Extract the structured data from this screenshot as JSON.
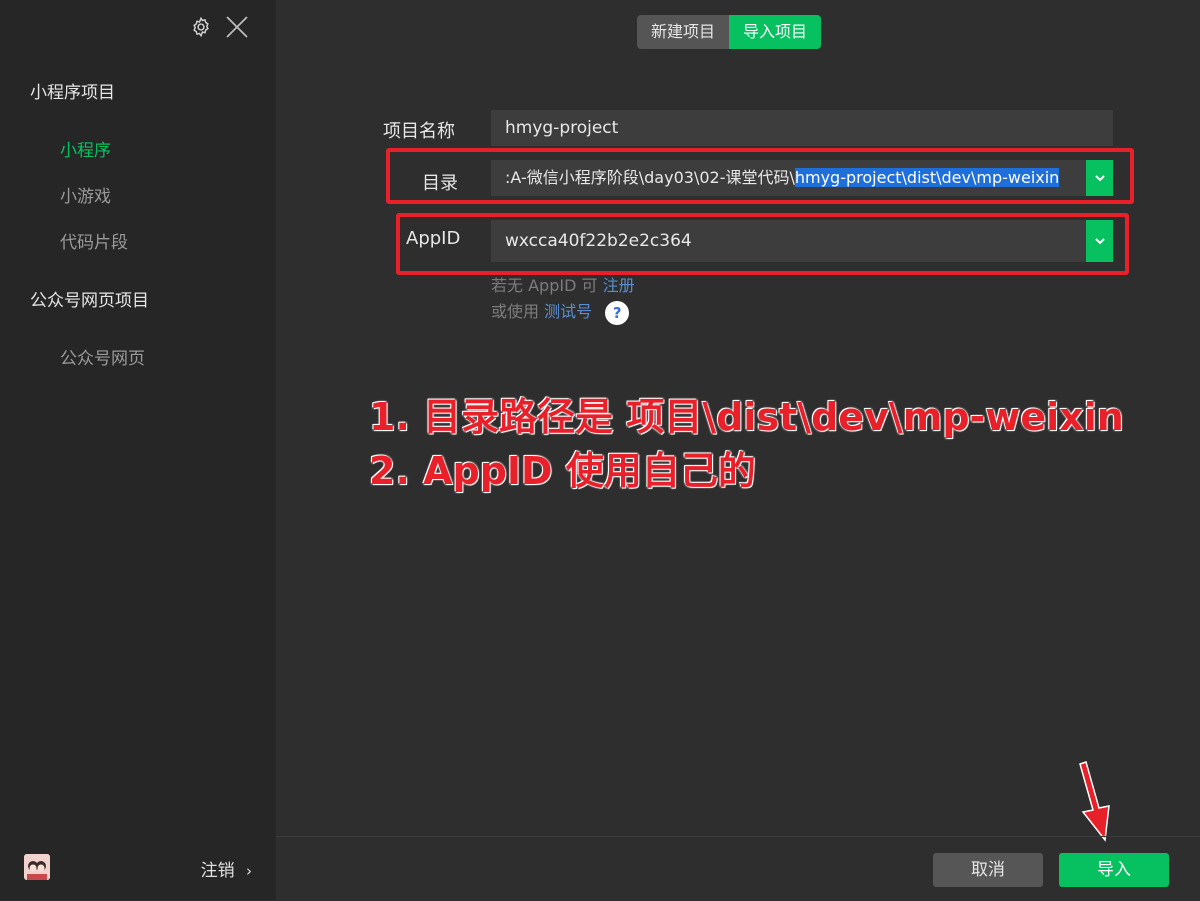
{
  "sidebar": {
    "sections": [
      {
        "title": "小程序项目",
        "items": [
          "小程序",
          "小游戏",
          "代码片段"
        ]
      },
      {
        "title": "公众号网页项目",
        "items": [
          "公众号网页"
        ]
      }
    ],
    "logout_label": "注销"
  },
  "tabs": {
    "new_project": "新建项目",
    "import_project": "导入项目"
  },
  "form": {
    "name_label": "项目名称",
    "name_value": "hmyg-project",
    "dir_label": "目录",
    "dir_value_prefix": ":A-微信小程序阶段\\day03\\02-课堂代码\\",
    "dir_value_selected": "hmyg-project\\dist\\dev\\mp-weixin",
    "appid_label": "AppID",
    "appid_value": "wxcca40f22b2e2c364",
    "hint_no_appid": "若无 AppID 可",
    "hint_register": "注册",
    "hint_or_use": "或使用",
    "hint_test": "测试号",
    "help_glyph": "?"
  },
  "annotation": {
    "line1": "1. 目录路径是 项目\\dist\\dev\\mp-weixin",
    "line2": "2. AppID 使用自己的",
    "color": "#e8202a"
  },
  "footer": {
    "cancel_label": "取消",
    "import_label": "导入"
  },
  "colors": {
    "accent": "#07c160",
    "sidebar_bg": "#262626",
    "main_bg": "#2e2e2e"
  }
}
